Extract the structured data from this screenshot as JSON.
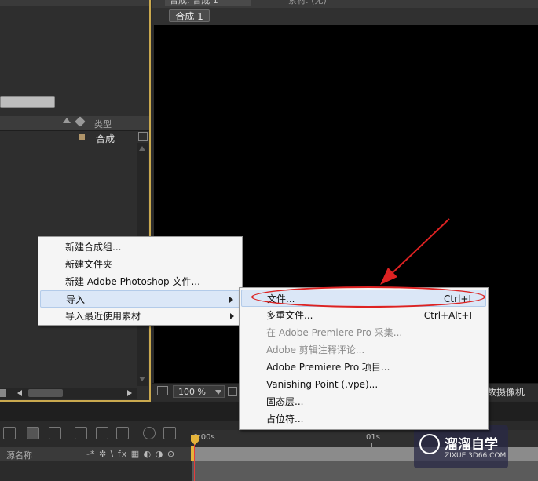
{
  "project_panel": {
    "column_type_label": "类型",
    "row_item_type": "合成"
  },
  "viewer": {
    "header_tab_comp": "合成: 合成 1",
    "header_tab_footage": "素材: (无)",
    "comp_tab_label": "合成 1",
    "zoom_value": "100 %",
    "camera_label": "数摄像机"
  },
  "timeline": {
    "column_source_name": "源名称",
    "switch_icons_text": "-* ✲ \\ fx ▦ ◐ ◑ ⊙",
    "time_ticks": [
      "0:00s",
      "01s"
    ]
  },
  "context_menu": {
    "items": [
      {
        "label": "新建合成组..."
      },
      {
        "label": "新建文件夹"
      },
      {
        "label": "新建 Adobe Photoshop 文件..."
      },
      {
        "label": "导入",
        "submenu": true
      },
      {
        "label": "导入最近使用素材",
        "submenu": true
      }
    ]
  },
  "import_submenu": {
    "items": [
      {
        "label": "文件...",
        "shortcut": "Ctrl+I"
      },
      {
        "label": "多重文件...",
        "shortcut": "Ctrl+Alt+I"
      },
      {
        "label": "在 Adobe Premiere Pro 采集...",
        "disabled": true
      },
      {
        "label": "Adobe 剪辑注释评论...",
        "disabled": true
      },
      {
        "label": "Adobe Premiere Pro 项目..."
      },
      {
        "label": "Vanishing Point (.vpe)..."
      },
      {
        "label": "固态层..."
      },
      {
        "label": "占位符..."
      }
    ]
  },
  "watermark": {
    "title": "溜溜自学",
    "url": "ZIXUE.3D66.COM"
  },
  "colors": {
    "panel_border": "#caa94f",
    "annotation": "#dd2222",
    "menu_highlight": "#dbe7f7"
  }
}
